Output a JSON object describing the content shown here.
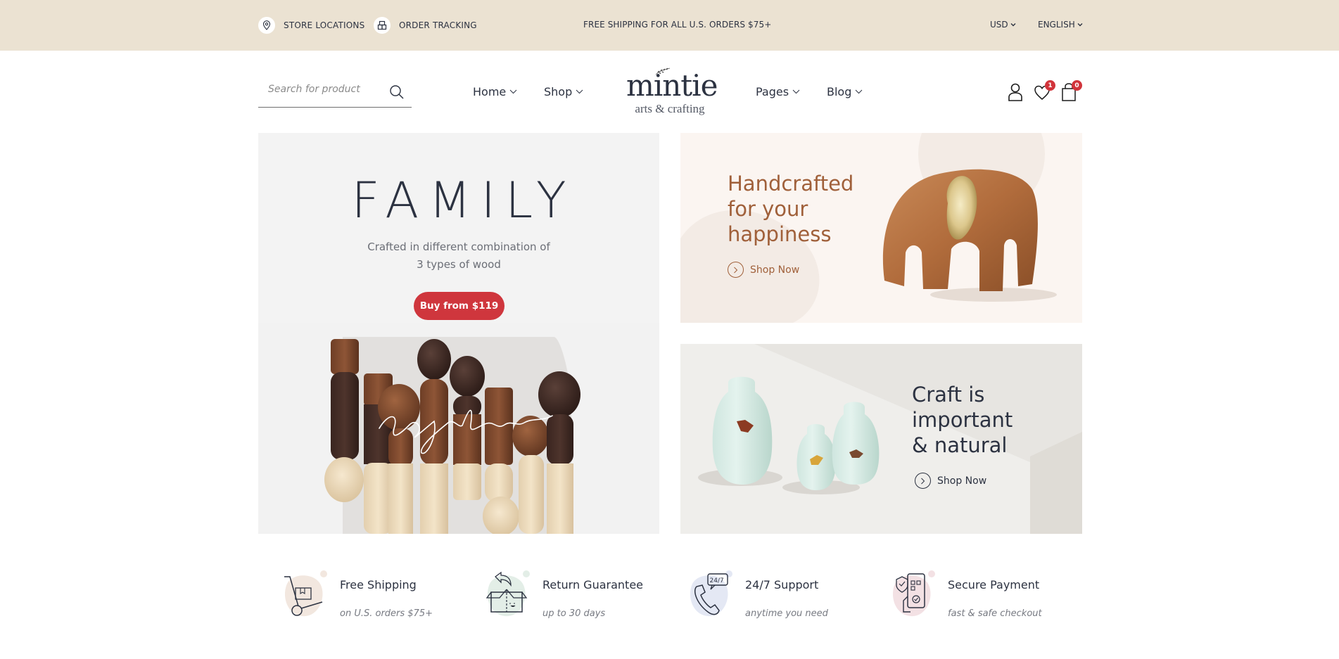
{
  "topbar": {
    "store_locations": "STORE LOCATIONS",
    "order_tracking": "ORDER TRACKING",
    "promo": "FREE SHIPPING FOR ALL U.S. ORDERS $75+",
    "currency": "USD",
    "language": "ENGLISH"
  },
  "header": {
    "search_placeholder": "Search for product",
    "search_value": "",
    "nav": [
      {
        "label": "Home"
      },
      {
        "label": "Shop"
      },
      {
        "label": "Pages"
      },
      {
        "label": "Blog"
      }
    ],
    "logo": {
      "word": "mintie",
      "tagline": "arts & crafting"
    },
    "wishlist_count": "1",
    "cart_count": "0"
  },
  "hero": {
    "title": "FAMILY",
    "subtitle_line1": "Crafted in different combination of",
    "subtitle_line2": "3 types of wood",
    "button": "Buy from $119",
    "script_overlay": "together"
  },
  "banners": [
    {
      "title_lines": [
        "Handcrafted",
        "for your",
        "happiness"
      ],
      "cta": "Shop Now"
    },
    {
      "title_lines": [
        "Craft is",
        "important",
        "& natural"
      ],
      "cta": "Shop Now"
    }
  ],
  "features": [
    {
      "icon": "hand-truck-icon",
      "title": "Free Shipping",
      "subtitle": "on U.S. orders $75+"
    },
    {
      "icon": "return-box-icon",
      "title": "Return Guarantee",
      "subtitle": "up to 30 days"
    },
    {
      "icon": "phone-support-icon",
      "title": "24/7 Support",
      "subtitle": "anytime you need"
    },
    {
      "icon": "secure-payment-icon",
      "title": "Secure Payment",
      "subtitle": "fast & safe checkout"
    }
  ],
  "colors": {
    "topbar_bg": "#ebe2d2",
    "accent_red": "#cf363d",
    "text_dark": "#2c3241",
    "banner1_text": "#a0603a",
    "hero_bg": "#f3f3f3",
    "banner1_bg": "#fbf5f1",
    "banner2_bg": "#ecebe8"
  }
}
